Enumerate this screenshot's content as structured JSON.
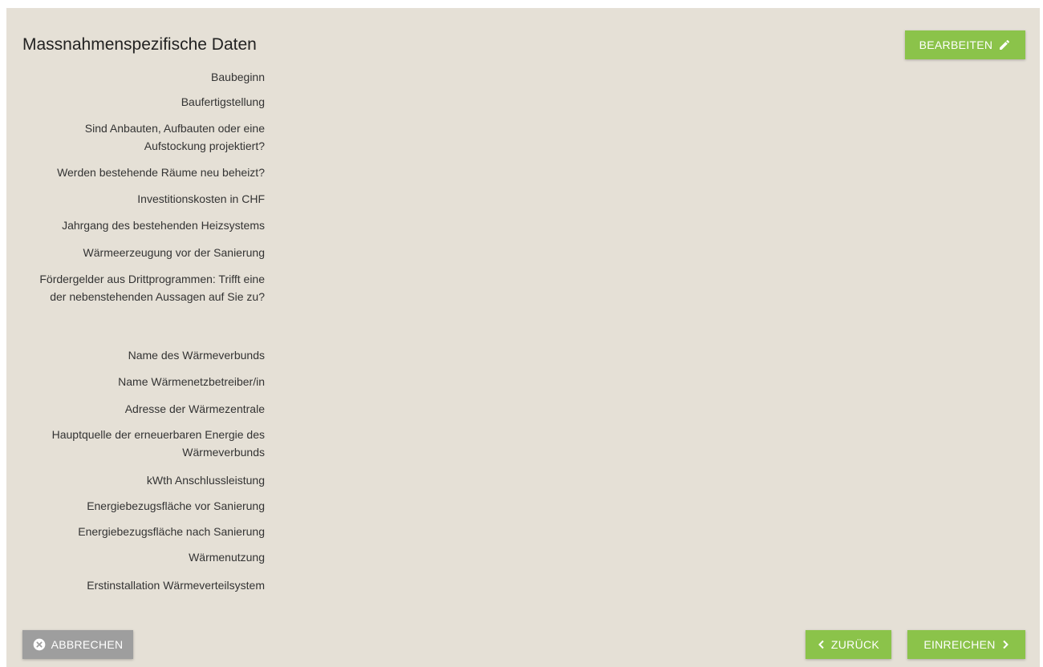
{
  "header": {
    "title": "Massnahmenspezifische Daten",
    "edit_label": "BEARBEITEN"
  },
  "fields": [
    "Baubeginn",
    "Baufertigstellung",
    "Sind Anbauten, Aufbauten oder eine Aufstockung projektiert?",
    "Werden bestehende Räume neu beheizt?",
    "Investitionskosten in CHF",
    "Jahrgang des bestehenden Heizsystems",
    "Wärmeerzeugung vor der Sanierung",
    "Fördergelder aus Drittprogrammen: Trifft eine der nebenstehenden Aussagen auf Sie zu?",
    "Name des Wärmeverbunds",
    "Name Wärmenetzbetreiber/in",
    "Adresse der Wärmezentrale",
    "Hauptquelle der erneuerbaren Energie des Wärmeverbunds",
    "kWth Anschlussleistung",
    "Energiebezugsfläche vor Sanierung",
    "Energiebezugsfläche nach Sanierung",
    "Wärmenutzung",
    "Erstinstallation Wärmeverteilsystem"
  ],
  "footer": {
    "cancel_label": "ABBRECHEN",
    "back_label": "ZURÜCK",
    "submit_label": "EINREICHEN"
  },
  "colors": {
    "background": "#e5e0d6",
    "primary_green": "#8bc34a",
    "cancel_grey": "#9e9e9e"
  },
  "icons": {
    "edit": "pencil-icon",
    "cancel": "close-circle-icon",
    "back": "chevron-left-icon",
    "submit": "chevron-right-icon"
  }
}
